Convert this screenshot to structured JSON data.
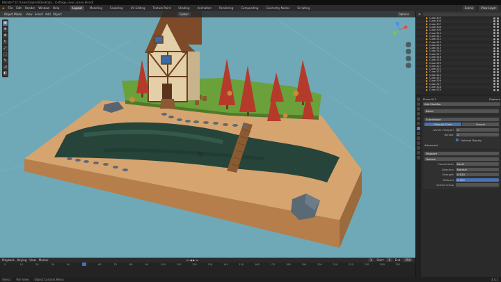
{
  "titlebar": {
    "title": "Blender* [C:\\Users\\Gabriel\\Desktop\\...\\cottage_river_scene.blend]"
  },
  "menu": [
    "File",
    "Edit",
    "Render",
    "Window",
    "Help"
  ],
  "workspaces": [
    {
      "label": "Layout",
      "active": true
    },
    {
      "label": "Modeling",
      "active": false
    },
    {
      "label": "Sculpting",
      "active": false
    },
    {
      "label": "UV Editing",
      "active": false
    },
    {
      "label": "Texture Paint",
      "active": false
    },
    {
      "label": "Shading",
      "active": false
    },
    {
      "label": "Animation",
      "active": false
    },
    {
      "label": "Rendering",
      "active": false
    },
    {
      "label": "Compositing",
      "active": false
    },
    {
      "label": "Geometry Nodes",
      "active": false
    },
    {
      "label": "Scripting",
      "active": false
    }
  ],
  "scene": {
    "label": "Scene",
    "view_layer": "View Layer"
  },
  "viewport": {
    "mode": "Object Mode",
    "menus": [
      "View",
      "Select",
      "Add",
      "Object"
    ],
    "transform": "Global",
    "options": "Options"
  },
  "outliner": {
    "rows": [
      "Cube.305",
      "Cube.306",
      "Cube.307",
      "Cube.308",
      "Cube.309",
      "Cube.310",
      "Cube.311",
      "Cube.312",
      "Cube.313",
      "Cube.314",
      "Cube.315",
      "Cube.316",
      "Cube.317",
      "Cube.318",
      "Cube.319",
      "Cube.320",
      "Cube.321",
      "Cube.322",
      "Cube.323",
      "Cube.324",
      "Cube.325",
      "Cube.326",
      "Cube.327",
      "Cube.328",
      "Cube.329"
    ]
  },
  "properties": {
    "object": "Plane.017",
    "modifier_tab": "Displace",
    "add_modifier": "Add Modifier",
    "bevel": "Bevel",
    "subdivision": "Subdivision",
    "seg_left": "Catmull-Clark",
    "seg_right": "Simple",
    "levels_viewport": "Levels Viewport",
    "render": "Render",
    "levels_value": "2",
    "render_value": "2",
    "optimal_display": "Optimal Display",
    "advanced": "Advanced",
    "displace": "Displace",
    "texture_label": "Texture",
    "coordinates_label": "Coordinates",
    "coordinates_value": "Local",
    "direction_label": "Direction",
    "direction_value": "Normal",
    "strength_label": "Strength",
    "strength_value": "0.020",
    "midlevel_label": "Midlevel",
    "midlevel_value": "0.500",
    "vertex_group_label": "Vertex Group"
  },
  "timeline": {
    "menus": [
      "Playback",
      "Keying",
      "View",
      "Marker"
    ],
    "current_frame": "1",
    "start": "1",
    "end": "250",
    "ticks": [
      "0",
      "10",
      "20",
      "30",
      "40",
      "50",
      "60",
      "70",
      "80",
      "90",
      "100",
      "110",
      "120",
      "130",
      "140",
      "150",
      "160",
      "170",
      "180",
      "190",
      "200",
      "210",
      "220",
      "230",
      "240",
      "250"
    ]
  },
  "status": {
    "left": "Select",
    "mid": "Pan View",
    "right": "Object Context Menu",
    "version": "3.4.1"
  },
  "colors": {
    "sky": "#6fa9b7",
    "sand": "#d4a26e",
    "grass": "#6aa13a",
    "tree": "#b63a2a",
    "water": "#2b4a3a",
    "accent": "#4772b3"
  }
}
